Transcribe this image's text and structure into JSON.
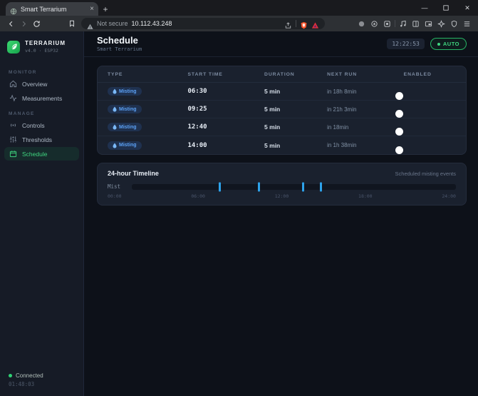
{
  "browser": {
    "tab_title": "Smart Terrarium",
    "security_label": "Not secure",
    "url": "10.112.43.248"
  },
  "sidebar": {
    "brand": {
      "name": "TERRARIUM",
      "meta": "v4.0 · ESP32"
    },
    "sections": [
      {
        "label": "MONITOR",
        "items": [
          {
            "label": "Overview",
            "icon": "home",
            "active": false
          },
          {
            "label": "Measurements",
            "icon": "activity",
            "active": false
          }
        ]
      },
      {
        "label": "MANAGE",
        "items": [
          {
            "label": "Controls",
            "icon": "radio",
            "active": false
          },
          {
            "label": "Thresholds",
            "icon": "sliders",
            "active": false
          },
          {
            "label": "Schedule",
            "icon": "calendar",
            "active": true
          }
        ]
      }
    ],
    "status": {
      "label": "Connected",
      "uptime": "01:48:03"
    }
  },
  "header": {
    "title": "Schedule",
    "subtitle": "Smart Terrarium",
    "clock": "12:22:53",
    "mode_badge": "AUTO"
  },
  "schedule_table": {
    "columns": [
      "Type",
      "Start Time",
      "Duration",
      "Next Run",
      "Enabled"
    ],
    "rows": [
      {
        "type": "Misting",
        "start": "06:30",
        "duration": "5 min",
        "next_run": "in 18h 8min",
        "enabled": true
      },
      {
        "type": "Misting",
        "start": "09:25",
        "duration": "5 min",
        "next_run": "in 21h 3min",
        "enabled": true
      },
      {
        "type": "Misting",
        "start": "12:40",
        "duration": "5 min",
        "next_run": "in 18min",
        "enabled": true
      },
      {
        "type": "Misting",
        "start": "14:00",
        "duration": "5 min",
        "next_run": "in 1h 38min",
        "enabled": true
      }
    ]
  },
  "timeline": {
    "title": "24-hour Timeline",
    "subtitle": "Scheduled misting events",
    "row_label": "Mist",
    "axis_labels": [
      "00:00",
      "06:00",
      "12:00",
      "18:00",
      "24:00"
    ],
    "event_times": [
      "06:30",
      "09:25",
      "12:40",
      "14:00"
    ],
    "hours_span": 24,
    "tick_color": "#2da2ea"
  },
  "colors": {
    "accent_green": "#23c162",
    "accent_blue": "#5ba1f5"
  }
}
